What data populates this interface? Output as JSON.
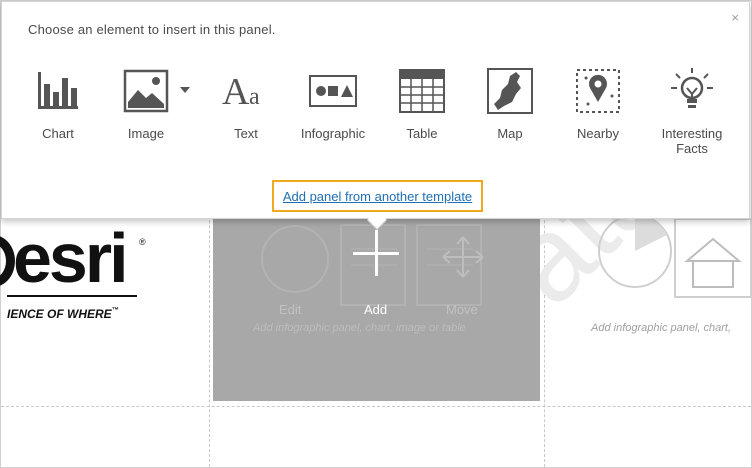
{
  "popover": {
    "title": "Choose an element to insert in this panel.",
    "close_glyph": "×",
    "tiles": [
      {
        "label": "Chart",
        "icon": "bar-chart-icon"
      },
      {
        "label": "Image",
        "icon": "image-icon",
        "has_dropdown": true,
        "dropdown_icon": "caret-down-icon"
      },
      {
        "label": "Text",
        "icon": "text-aa-icon"
      },
      {
        "label": "Infographic",
        "icon": "shapes-icon"
      },
      {
        "label": "Table",
        "icon": "table-icon"
      },
      {
        "label": "Map",
        "icon": "map-icon"
      },
      {
        "label": "Nearby",
        "icon": "map-pin-icon"
      },
      {
        "label": "Interesting\nFacts",
        "icon": "lightbulb-icon"
      }
    ],
    "link_label": "Add panel from another template",
    "highlight_color": "#f0a81c",
    "link_color": "#1f6fb5"
  },
  "canvas": {
    "logo": {
      "word": "esri",
      "registered": "®",
      "tagline": "IENCE OF WHERE",
      "trademark": "™"
    },
    "panel": {
      "edit_label": "Edit",
      "add_label": "Add",
      "move_label": "Move",
      "hint": "Add infographic panel, chart, image or table"
    },
    "right_hint": "Add infographic panel, chart,",
    "watermark": "Data"
  }
}
